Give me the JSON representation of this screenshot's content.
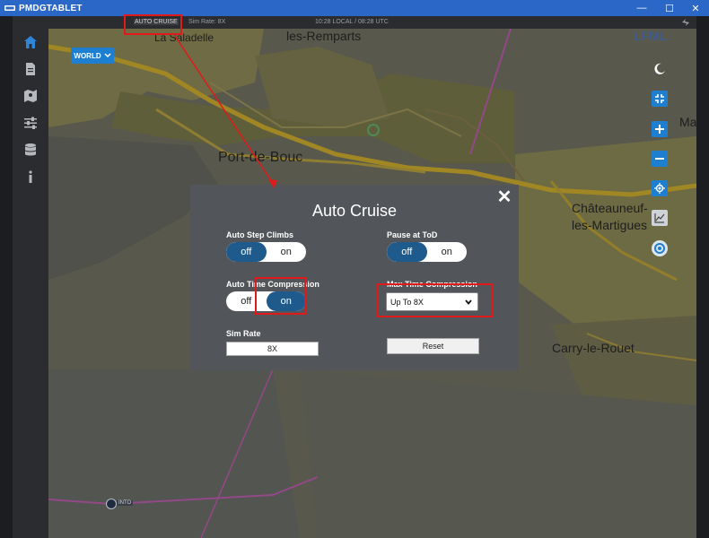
{
  "window": {
    "title": "PMDGTABLET",
    "controls": {
      "minimize": "—",
      "maximize": "☐",
      "close": "✕"
    }
  },
  "topbar": {
    "auto_cruise_label": "AUTO CRUISE",
    "sim_rate": "Sim Rate: 8X",
    "time": "10:28 LOCAL / 08:28 UTC"
  },
  "sidebar": {
    "items": [
      {
        "icon": "home-icon"
      },
      {
        "icon": "document-icon"
      },
      {
        "icon": "map-icon"
      },
      {
        "icon": "sliders-icon"
      },
      {
        "icon": "database-icon"
      },
      {
        "icon": "info-icon"
      }
    ]
  },
  "map": {
    "world_button": "WORLD",
    "airport_code": "LFML",
    "waypoint_label": "INTO",
    "labels": {
      "la_saladelle": "La Saladelle",
      "les_remparts": "les-Remparts",
      "port_de_bouc": "Port-de-Bouc",
      "chateauneuf_1": "Châteauneuf-",
      "chateauneuf_2": "les-Martigues",
      "carry_le_rouet": "Carry-le-Rouet",
      "ma": "Ma"
    },
    "tools": [
      {
        "icon": "moon-icon"
      },
      {
        "icon": "collapse-icon"
      },
      {
        "icon": "zoom-in-icon"
      },
      {
        "icon": "zoom-out-icon"
      },
      {
        "icon": "locate-icon"
      },
      {
        "icon": "chart-icon"
      },
      {
        "icon": "rotate-icon"
      }
    ]
  },
  "modal": {
    "title": "Auto Cruise",
    "close": "✕",
    "auto_step_climbs": {
      "label": "Auto Step Climbs",
      "off": "off",
      "on": "on",
      "value": "off"
    },
    "pause_at_tod": {
      "label": "Pause at ToD",
      "off": "off",
      "on": "on",
      "value": "off"
    },
    "auto_time_compression": {
      "label": "Auto Time Compression",
      "off": "off",
      "on": "on",
      "value": "on"
    },
    "max_time_compression": {
      "label": "Max Time Compression",
      "value": "Up To 8X"
    },
    "sim_rate": {
      "label": "Sim Rate",
      "value": "8X"
    },
    "reset": "Reset"
  },
  "colors": {
    "accent": "#1e7fd0",
    "toggle_selected": "#1f5a8c",
    "annotation": "#e01a1a"
  }
}
